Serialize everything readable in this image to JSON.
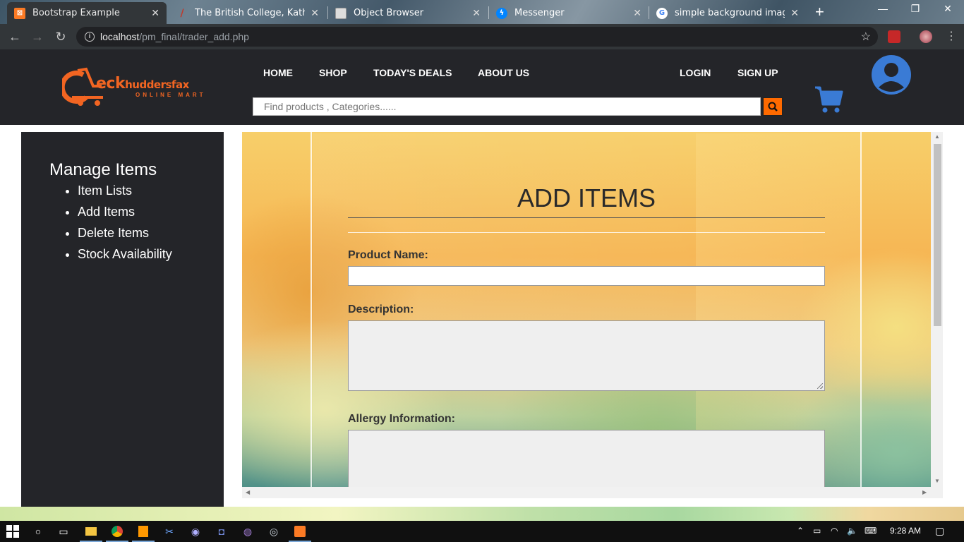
{
  "browser": {
    "tabs": [
      {
        "title": "Bootstrap Example",
        "active": true,
        "favicon": "xampp-icon",
        "color": "#fb7a24"
      },
      {
        "title": "The British College, Kathmandu",
        "active": false,
        "favicon": "college-icon",
        "color": "#c0392b"
      },
      {
        "title": "Object Browser",
        "active": false,
        "favicon": "page-icon",
        "color": "#dddddd"
      },
      {
        "title": "Messenger",
        "active": false,
        "favicon": "messenger-icon",
        "color": "#0084ff"
      },
      {
        "title": "simple background image - Google",
        "active": false,
        "favicon": "google-icon",
        "color": "#ffffff"
      }
    ],
    "url_host": "localhost",
    "url_path": "/pm_final/trader_add.php"
  },
  "header": {
    "logo_word": "eck",
    "logo_word2": "huddersfax",
    "logo_sub": "ONLINE MART",
    "nav": {
      "home": "HOME",
      "shop": "SHOP",
      "deals": "TODAY'S DEALS",
      "about": "ABOUT US",
      "login": "LOGIN",
      "signup": "SIGN UP"
    },
    "search_placeholder": "Find products , Categories......"
  },
  "sidebar": {
    "title": "Manage Items",
    "items": [
      "Item Lists",
      "Add Items",
      "Delete Items",
      "Stock Availability"
    ]
  },
  "form": {
    "title": "ADD ITEMS",
    "product_name_label": "Product Name:",
    "description_label": "Description:",
    "allergy_label": "Allergy Information:"
  },
  "taskbar": {
    "time": "9:28 AM"
  },
  "colors": {
    "accent": "#ff6a00",
    "header_bg": "#242529",
    "cart_blue": "#3a7bd5"
  }
}
